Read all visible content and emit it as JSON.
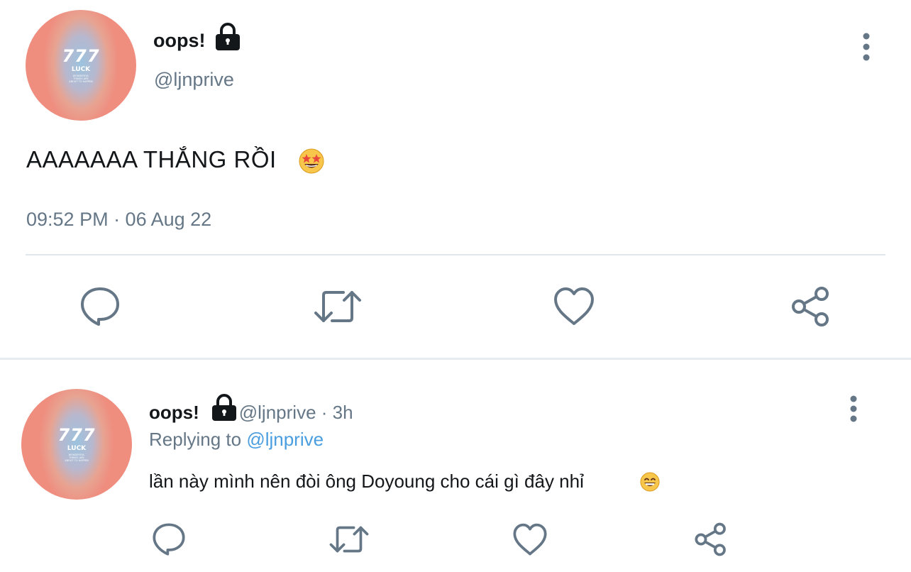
{
  "main_tweet": {
    "author_name": "oops!",
    "handle": "@ljnprive",
    "text": "AAAAAAA THẮNG RỒI",
    "emoji": "star-struck",
    "timestamp": "09:52 PM · 06 Aug 22",
    "avatar": {
      "number": "777",
      "word": "LUCK",
      "small_text": "WONDERFUL THINGS ARE ABOUT TO HAPPEN"
    }
  },
  "actions": [
    "reply-icon",
    "retweet-icon",
    "like-icon",
    "share-icon"
  ],
  "reply_tweet": {
    "author_name": "oops!",
    "handle": "@ljnprive",
    "separator": "·",
    "time_ago": "3h",
    "replying_prefix": "Replying to",
    "replying_to": "@ljnprive",
    "text": "lần này mình nên đòi ông Doyoung cho cái gì đây nhỉ",
    "emoji": "grinning-face",
    "avatar": {
      "number": "777",
      "word": "LUCK",
      "small_text": "WONDERFUL THINGS ARE ABOUT TO HAPPEN"
    }
  },
  "colors": {
    "text_primary": "#14171a",
    "text_secondary": "#657786",
    "link": "#4a9ee0",
    "icon": "#657786",
    "divider": "#e1e6ea"
  }
}
